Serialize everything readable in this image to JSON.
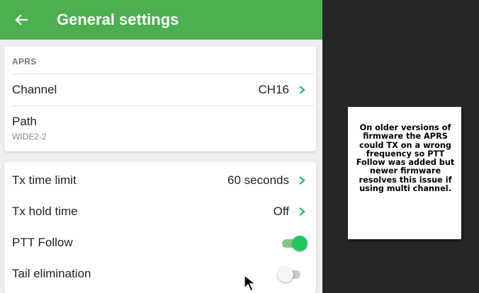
{
  "appbar": {
    "title": "General settings",
    "back_icon": "arrow-left-icon"
  },
  "aprs": {
    "header": "APRS",
    "channel": {
      "label": "Channel",
      "value": "CH16"
    },
    "path": {
      "label": "Path",
      "value": "WIDE2-2"
    }
  },
  "tx": {
    "time_limit": {
      "label": "Tx time limit",
      "value": "60 seconds"
    },
    "hold_time": {
      "label": "Tx hold time",
      "value": "Off"
    },
    "ptt_follow": {
      "label": "PTT Follow",
      "enabled": true
    },
    "tail_elimination": {
      "label": "Tail elimination",
      "enabled": false
    }
  },
  "annotation": {
    "text": "On older versions of firmware the APRS could TX on a wrong frequency so PTT Follow was added but newer firmware resolves this issue if using multi channel."
  },
  "colors": {
    "appbar": "#4caf50",
    "accent": "#22c55e",
    "background_dark": "#262626"
  }
}
